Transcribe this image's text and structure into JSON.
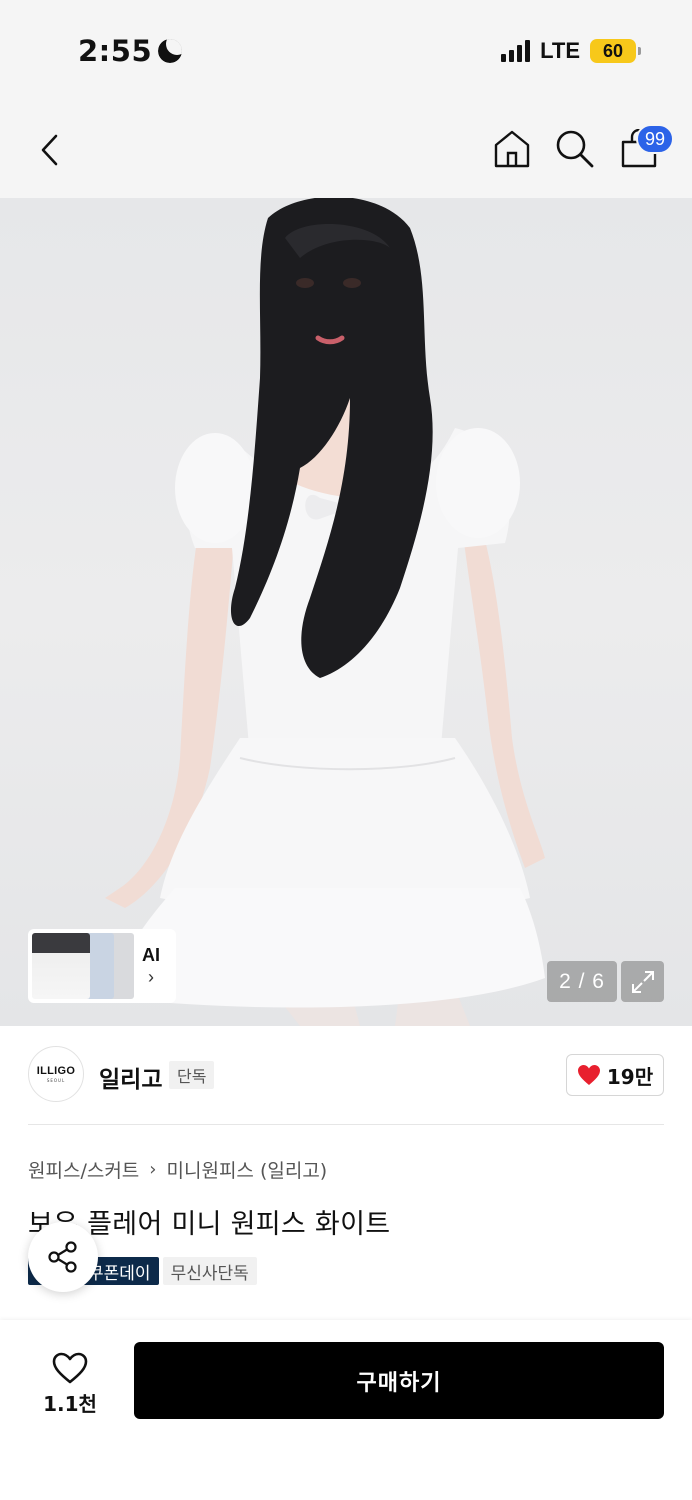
{
  "status_bar": {
    "time": "2:55",
    "network": "LTE",
    "battery": "60"
  },
  "header": {
    "icons": [
      "back-icon",
      "home-icon",
      "search-icon",
      "shopping-bag-icon"
    ],
    "cart_count": "99"
  },
  "gallery": {
    "ai_label": "AI",
    "page_counter": "2 / 6"
  },
  "brand": {
    "logo_text": "ILLIGO",
    "logo_subtext": "SEOUL",
    "name": "일리고",
    "tag": "단독",
    "like_count": "19만"
  },
  "product": {
    "breadcrumb": [
      "원피스/스커트",
      "미니원피스 (일리고)"
    ],
    "title": "보우 플레어 미니 원피스 화이트",
    "tags": [
      "쿠폰데이",
      "무신사단독"
    ]
  },
  "bottom_bar": {
    "wish_count": "1.1천",
    "buy_label": "구매하기"
  },
  "colors": {
    "accent_blue": "#2c63e8",
    "heart_red": "#e8202e",
    "buy_button": "#000000",
    "tag_dark": "#0d2a4a"
  }
}
